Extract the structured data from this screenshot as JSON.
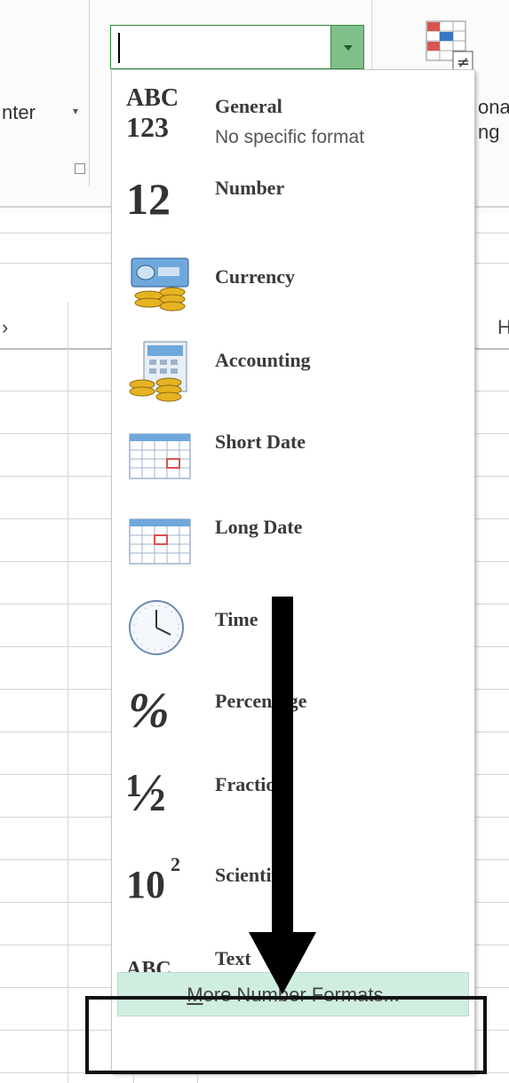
{
  "ribbon": {
    "left_text": "nter",
    "right_text_top": "onal",
    "right_text_bottom": "ng",
    "column_letter": "H"
  },
  "number_format_box": {
    "value": ""
  },
  "menu": {
    "items": [
      {
        "label": "General",
        "sublabel": "No specific format",
        "icon": "general-abc-123-icon",
        "glyph_a": "ABC",
        "glyph_b": "123"
      },
      {
        "label": "Number",
        "icon": "number-12-icon",
        "glyph": "12"
      },
      {
        "label": "Currency",
        "icon": "currency-icon"
      },
      {
        "label": "Accounting",
        "icon": "accounting-icon"
      },
      {
        "label": "Short Date",
        "icon": "calendar-icon"
      },
      {
        "label": "Long Date",
        "icon": "calendar-icon"
      },
      {
        "label": "Time",
        "icon": "clock-icon"
      },
      {
        "label": "Percentage",
        "icon": "percent-icon",
        "glyph": "%"
      },
      {
        "label": "Fraction",
        "icon": "fraction-icon",
        "glyph": "½"
      },
      {
        "label": "Scientific",
        "icon": "scientific-icon",
        "glyph": "10",
        "glyph_sup": "2"
      },
      {
        "label": "Text",
        "icon": "text-abc-icon",
        "glyph": "ABC"
      }
    ],
    "more_label_prefix": "M",
    "more_label_rest": "ore Number Formats..."
  },
  "colors": {
    "combo_border": "#2e8b3a",
    "combo_button": "#7fc08a",
    "more_button_bg": "#cfeee0",
    "arrow": "#000000"
  }
}
